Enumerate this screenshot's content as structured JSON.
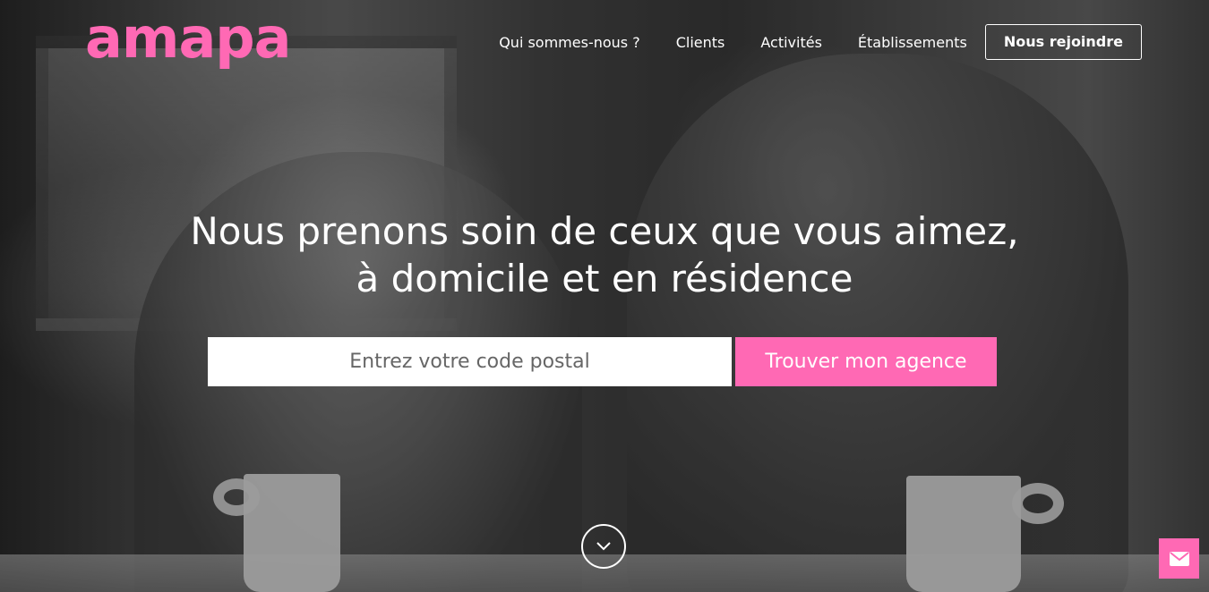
{
  "brand": {
    "logo_text": "amapa",
    "accent_color": "#ff69b4"
  },
  "nav": {
    "items": [
      {
        "label": "Qui sommes-nous ?"
      },
      {
        "label": "Clients"
      },
      {
        "label": "Activités"
      },
      {
        "label": "Établissements"
      }
    ],
    "cta_label": "Nous rejoindre"
  },
  "hero": {
    "headline_line1": "Nous prenons soin de ceux que vous aimez,",
    "headline_line2": "à domicile et en résidence"
  },
  "search": {
    "placeholder": "Entrez votre code postal",
    "button_label": "Trouver mon agence"
  },
  "icons": {
    "scroll": "chevron-down-icon",
    "contact": "envelope-icon"
  }
}
